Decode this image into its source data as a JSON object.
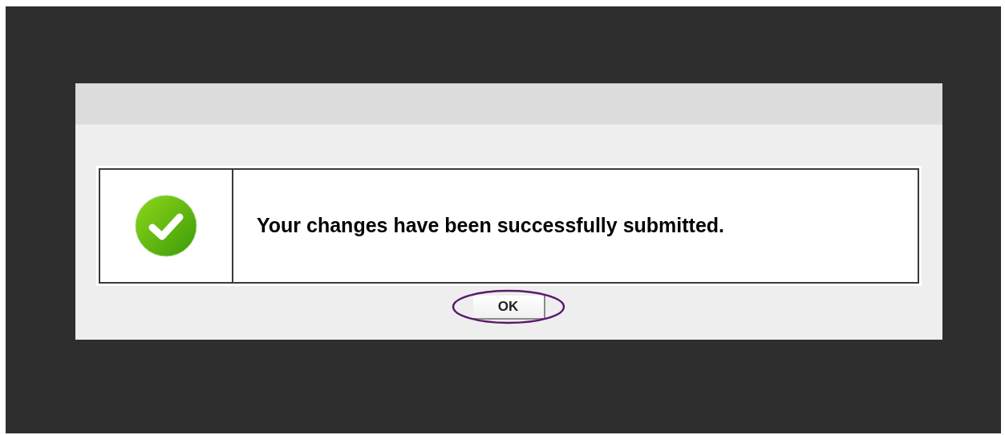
{
  "dialog": {
    "kind": "success",
    "message": "Your changes have been successfully submitted."
  },
  "buttons": [
    {
      "label": "OK",
      "highlighted": true
    }
  ]
}
